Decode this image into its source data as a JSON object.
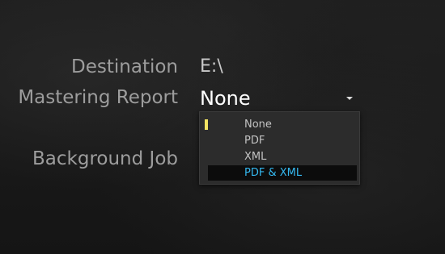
{
  "settings": {
    "destination": {
      "label": "Destination",
      "value": "E:\\"
    },
    "mastering_report": {
      "label": "Mastering Report",
      "value": "None",
      "options": [
        "None",
        "PDF",
        "XML",
        "PDF & XML"
      ],
      "selected_option": "None",
      "highlighted_option": "PDF & XML"
    },
    "background_job": {
      "label": "Background Job"
    }
  },
  "colors": {
    "selection_indicator": "#f3e463",
    "highlight_text": "#34b8f0",
    "highlight_background": "#0c0c0c"
  }
}
